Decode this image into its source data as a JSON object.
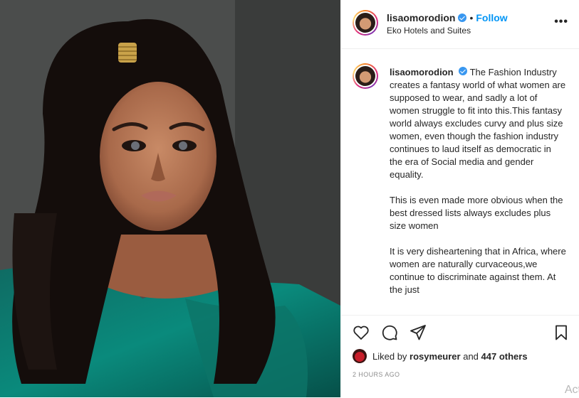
{
  "post": {
    "username": "lisaomorodion",
    "follow_label": "Follow",
    "dot": "•",
    "location": "Eko Hotels and Suites",
    "more_label": "•••"
  },
  "caption": {
    "username": "lisaomorodion",
    "paragraphs": [
      "The Fashion Industry creates a fantasy world of what women are supposed to wear, and sadly a lot of women struggle to fit into this.This fantasy world always excludes curvy and plus size women, even though the fashion industry continues to laud itself as democratic in the era of Social media and gender equality.",
      "This is even made more obvious when the best dressed lists always excludes plus size women",
      "It is very disheartening that in Africa, where women are naturally curvaceous,we continue to discriminate against them. At the just"
    ]
  },
  "actions": {
    "like_icon": "heart-icon",
    "comment_icon": "comment-icon",
    "share_icon": "send-icon",
    "save_icon": "bookmark-icon"
  },
  "likes": {
    "prefix": "Liked by",
    "user": "rosymeurer",
    "joiner": "and",
    "count": "447 others"
  },
  "timestamp": "2 HOURS AGO",
  "corner_text": "Act",
  "colors": {
    "link": "#0095f6",
    "verified": "#3897f0",
    "text": "#262626",
    "muted": "#8e8e8e"
  }
}
